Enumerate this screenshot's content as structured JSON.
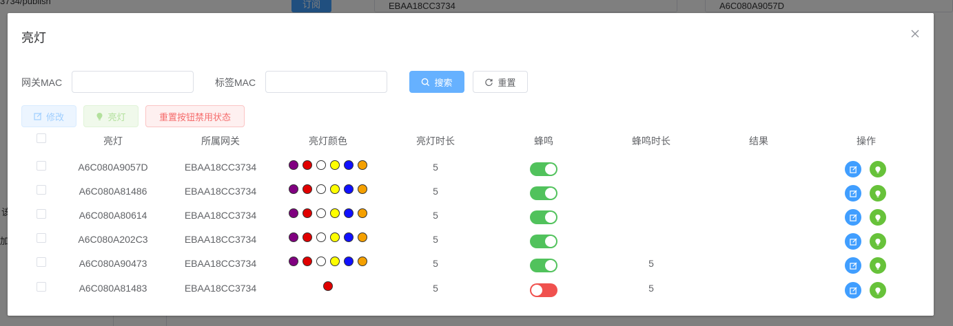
{
  "background": {
    "topic_text": "3734/publish",
    "subscribe_button": "订阅",
    "field1": "EBAA18CC3734",
    "field2": "A6C080A9057D",
    "left_text1": "该",
    "left_text2": "加"
  },
  "dialog": {
    "title": "亮灯",
    "filters": {
      "gateway_label": "网关MAC",
      "gateway_value": "",
      "tag_label": "标签MAC",
      "tag_value": ""
    },
    "buttons": {
      "search": "搜索",
      "reset": "重置",
      "edit": "修改",
      "light": "亮灯",
      "reset_state": "重置按钮禁用状态"
    },
    "table": {
      "headers": [
        "亮灯",
        "所属网关",
        "亮灯颜色",
        "亮灯时长",
        "蜂鸣",
        "蜂鸣时长",
        "结果",
        "操作"
      ],
      "rows": [
        {
          "tag": "A6C080A9057D",
          "gateway": "EBAA18CC3734",
          "colors": [
            "#800080",
            "#e00000",
            "#ffffff",
            "#ffff00",
            "#1010ff",
            "#f5a000"
          ],
          "duration": "5",
          "buzzer": true,
          "buzz_duration": "",
          "result": ""
        },
        {
          "tag": "A6C080A81486",
          "gateway": "EBAA18CC3734",
          "colors": [
            "#800080",
            "#e00000",
            "#ffffff",
            "#ffff00",
            "#1010ff",
            "#f5a000"
          ],
          "duration": "5",
          "buzzer": true,
          "buzz_duration": "",
          "result": ""
        },
        {
          "tag": "A6C080A80614",
          "gateway": "EBAA18CC3734",
          "colors": [
            "#800080",
            "#e00000",
            "#ffffff",
            "#ffff00",
            "#1010ff",
            "#f5a000"
          ],
          "duration": "5",
          "buzzer": true,
          "buzz_duration": "",
          "result": ""
        },
        {
          "tag": "A6C080A202C3",
          "gateway": "EBAA18CC3734",
          "colors": [
            "#800080",
            "#e00000",
            "#ffffff",
            "#ffff00",
            "#1010ff",
            "#f5a000"
          ],
          "duration": "5",
          "buzzer": true,
          "buzz_duration": "",
          "result": ""
        },
        {
          "tag": "A6C080A90473",
          "gateway": "EBAA18CC3734",
          "colors": [
            "#800080",
            "#e00000",
            "#ffffff",
            "#ffff00",
            "#1010ff",
            "#f5a000"
          ],
          "duration": "5",
          "buzzer": true,
          "buzz_duration": "5",
          "result": ""
        },
        {
          "tag": "A6C080A81483",
          "gateway": "EBAA18CC3734",
          "colors": [
            "#e00000"
          ],
          "duration": "5",
          "buzzer": false,
          "buzz_duration": "5",
          "result": ""
        }
      ]
    }
  },
  "icons": {
    "close": "close-icon",
    "search": "search-icon",
    "refresh": "refresh-icon",
    "edit": "edit-icon",
    "bulb": "bulb-icon"
  },
  "colors": {
    "primary": "#409eff",
    "success": "#67c23a",
    "danger": "#f56c6c",
    "switch_on": "#51c25c",
    "switch_off": "#f0514e"
  }
}
